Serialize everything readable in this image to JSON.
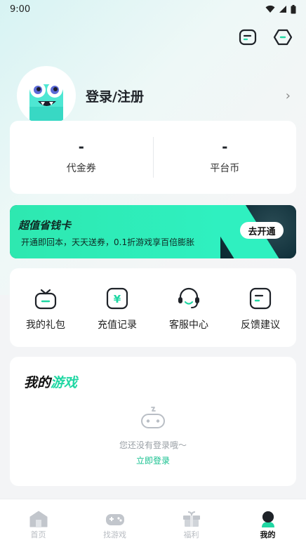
{
  "status_bar": {
    "time": "9:00"
  },
  "profile": {
    "login_label": "登录/注册"
  },
  "stats": [
    {
      "value": "-",
      "label": "代金券"
    },
    {
      "value": "-",
      "label": "平台币"
    }
  ],
  "banner": {
    "title": "超值省钱卡",
    "subtitle": "开通即回本，天天送券，0.1折游戏享百倍膨胀",
    "button": "去开通"
  },
  "shortcuts": [
    {
      "label": "我的礼包",
      "icon": "gift-box-icon"
    },
    {
      "label": "充值记录",
      "icon": "recharge-record-icon"
    },
    {
      "label": "客服中心",
      "icon": "headset-icon"
    },
    {
      "label": "反馈建议",
      "icon": "feedback-icon"
    }
  ],
  "my_games": {
    "title_part1": "我的",
    "title_part2": "游戏",
    "empty_text": "您还没有登录哦～",
    "login_link": "立即登录"
  },
  "tabs": [
    {
      "label": "首页",
      "icon": "home-icon",
      "active": false
    },
    {
      "label": "找游戏",
      "icon": "gamepad-icon",
      "active": false
    },
    {
      "label": "福利",
      "icon": "gift-icon",
      "active": false
    },
    {
      "label": "我的",
      "icon": "profile-icon",
      "active": true
    }
  ],
  "colors": {
    "accent": "#20d7a3",
    "link": "#16c08f",
    "banner_dark": "#10303a"
  }
}
